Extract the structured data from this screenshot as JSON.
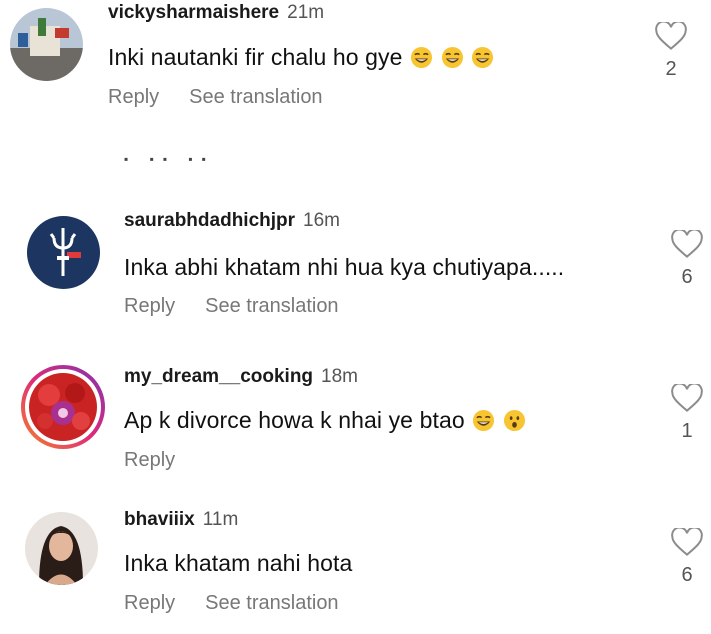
{
  "comments": [
    {
      "username": "vickysharmaishere",
      "time": "21m",
      "text": "Inki nautanki fir chalu ho gye",
      "emojis": [
        "laugh-emoji",
        "laugh-emoji",
        "laugh-emoji"
      ],
      "likes": "2",
      "actions": [
        "Reply",
        "See translation"
      ]
    },
    {
      "username": "saurabhdadhichjpr",
      "time": "16m",
      "text": "Inka abhi khatam nhi hua kya chutiyapa.....",
      "emojis": [],
      "likes": "6",
      "actions": [
        "Reply",
        "See translation"
      ]
    },
    {
      "username": "my_dream__cooking",
      "time": "18m",
      "text": "Ap k divorce howa k nhai ye btao",
      "emojis": [
        "laugh-emoji",
        "surprised-emoji"
      ],
      "likes": "1",
      "actions": [
        "Reply"
      ]
    },
    {
      "username": "bhaviiix",
      "time": "11m",
      "text": "Inka khatam nahi hota",
      "emojis": [],
      "likes": "6",
      "actions": [
        "Reply",
        "See translation"
      ]
    }
  ],
  "colors": {
    "text": "#111111",
    "muted": "#777777",
    "avatar_navy": "#1c3561",
    "story_ring_start": "#f58529",
    "story_ring_end": "#c13584"
  }
}
